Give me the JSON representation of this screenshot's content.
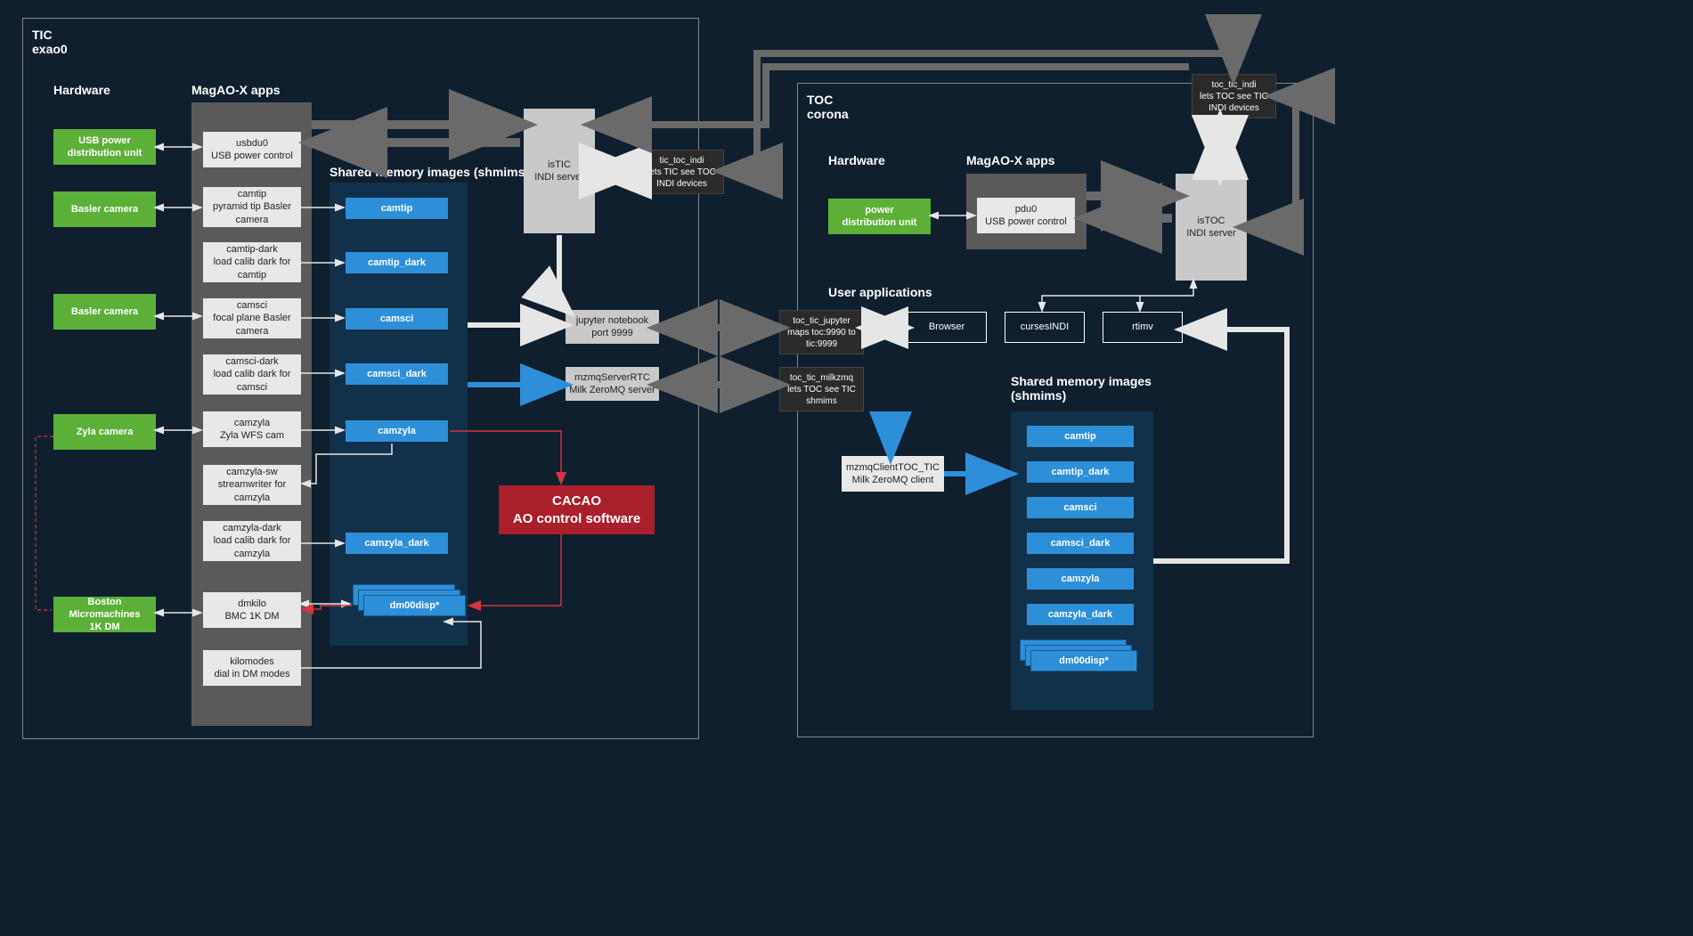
{
  "tic": {
    "title1": "TIC",
    "title2": "exao0",
    "hardware_title": "Hardware",
    "apps_title": "MagAO-X apps",
    "shmim_title": "Shared memory images (shmims)",
    "hw": {
      "usb": "USB power\ndistribution unit",
      "basler1": "Basler camera",
      "basler2": "Basler camera",
      "zyla": "Zyla camera",
      "bmc": "Boston Micromachines\n1K DM"
    },
    "apps": {
      "usbdu0": "usbdu0\nUSB power control",
      "camtip": "camtip\npyramid tip Basler\ncamera",
      "camtip_dark": "camtip-dark\nload calib dark for\ncamtip",
      "camsci": "camsci\nfocal plane Basler\ncamera",
      "camsci_dark": "camsci-dark\nload calib dark for\ncamsci",
      "camzyla": "camzyla\nZyla WFS cam",
      "camzyla_sw": "camzyla-sw\nstreamwriter for\ncamzyla",
      "camzyla_dark": "camzyla-dark\nload calib dark for\ncamzyla",
      "dmkilo": "dmkilo\nBMC 1K DM",
      "kilomodes": "kilomodes\ndial in DM modes"
    },
    "shmims": {
      "camtip": "camtip",
      "camtip_dark": "camtip_dark",
      "camsci": "camsci",
      "camsci_dark": "camsci_dark",
      "camzyla": "camzyla",
      "camzyla_dark": "camzyla_dark",
      "dm00disp": "dm00disp*"
    },
    "istic": "isTIC\nINDI server",
    "jupyter": "jupyter notebook\nport 9999",
    "mzmq": "mzmqServerRTC\nMilk ZeroMQ server",
    "cacao": "CACAO\nAO control software",
    "tic_toc_indi": "tic_toc_indi\nlets TIC see TOC\nINDI devices"
  },
  "toc": {
    "title1": "TOC",
    "title2": "corona",
    "hardware_title": "Hardware",
    "apps_title": "MagAO-X apps",
    "userapps_title": "User applications",
    "shmim_title": "Shared memory images\n(shmims)",
    "hw": {
      "pdu": "power\ndistribution unit"
    },
    "apps": {
      "pdu0": "pdu0\nUSB power control"
    },
    "istoc": "isTOC\nINDI server",
    "toc_tic_indi": "toc_tic_indi\nlets TOC see TIC\nINDI devices",
    "toc_tic_jupyter": "toc_tic_jupyter\nmaps toc:9990 to\ntic:9999",
    "toc_tic_milkzmq": "toc_tic_milkzmq\nlets TOC see TIC\nshmims",
    "mzmq_client": "mzmqClientTOC_TIC\nMilk ZeroMQ client",
    "userapps": {
      "browser": "Browser",
      "cursesindi": "cursesINDI",
      "rtimv": "rtimv"
    },
    "shmims": {
      "camtip": "camtip",
      "camtip_dark": "camtip_dark",
      "camsci": "camsci",
      "camsci_dark": "camsci_dark",
      "camzyla": "camzyla",
      "camzyla_dark": "camzyla_dark",
      "dm00disp": "dm00disp*"
    }
  }
}
